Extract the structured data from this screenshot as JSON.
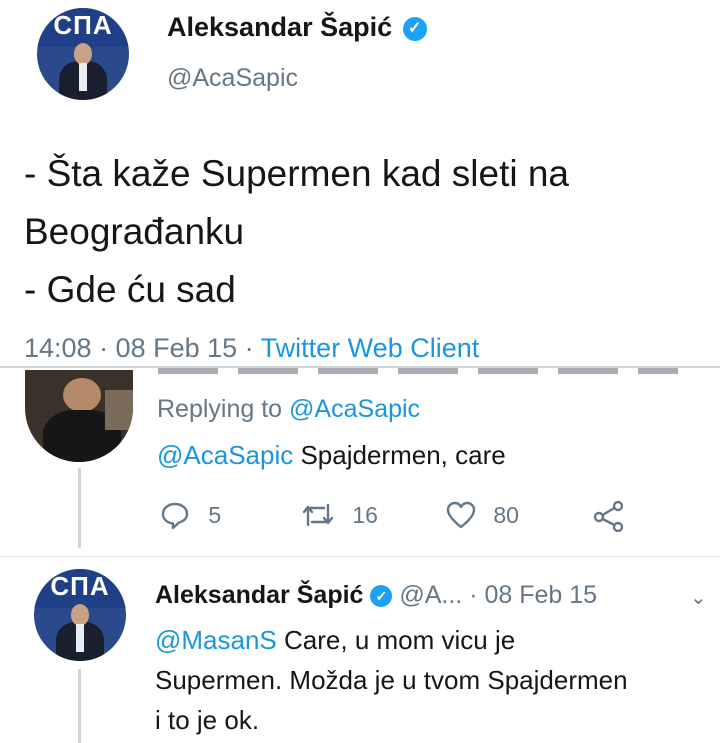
{
  "main_tweet": {
    "author_name": "Aleksandar Šapić",
    "handle": "@AcaSapic",
    "avatar_logo_text": "СПА",
    "text_lines": [
      "- Šta kaže Supermen kad sleti na",
      "Beograđanku",
      "- Gde ću sad"
    ],
    "timestamp": "14:08 · 08 Feb 15 ·",
    "client": "Twitter Web Client"
  },
  "reply_tweet": {
    "replying_prefix": "Replying to",
    "replying_handle": "@AcaSapic",
    "mention": "@AcaSapic",
    "text": "Spajdermen, care",
    "actions": {
      "replies": "5",
      "retweets": "16",
      "likes": "80"
    }
  },
  "second_reply": {
    "author_name": "Aleksandar Šapić",
    "handle_truncated": "@A...",
    "date": "· 08 Feb 15",
    "avatar_logo_text": "СПА",
    "mention": "@MasanS",
    "line1_rest": "Care, u mom vicu je",
    "line2": "Supermen. Možda je u tvom Spajdermen",
    "line3": "i to je ok."
  },
  "colors": {
    "link_blue": "#1b95e0",
    "verified_blue": "#1da1f2",
    "gray_text": "#657786"
  }
}
